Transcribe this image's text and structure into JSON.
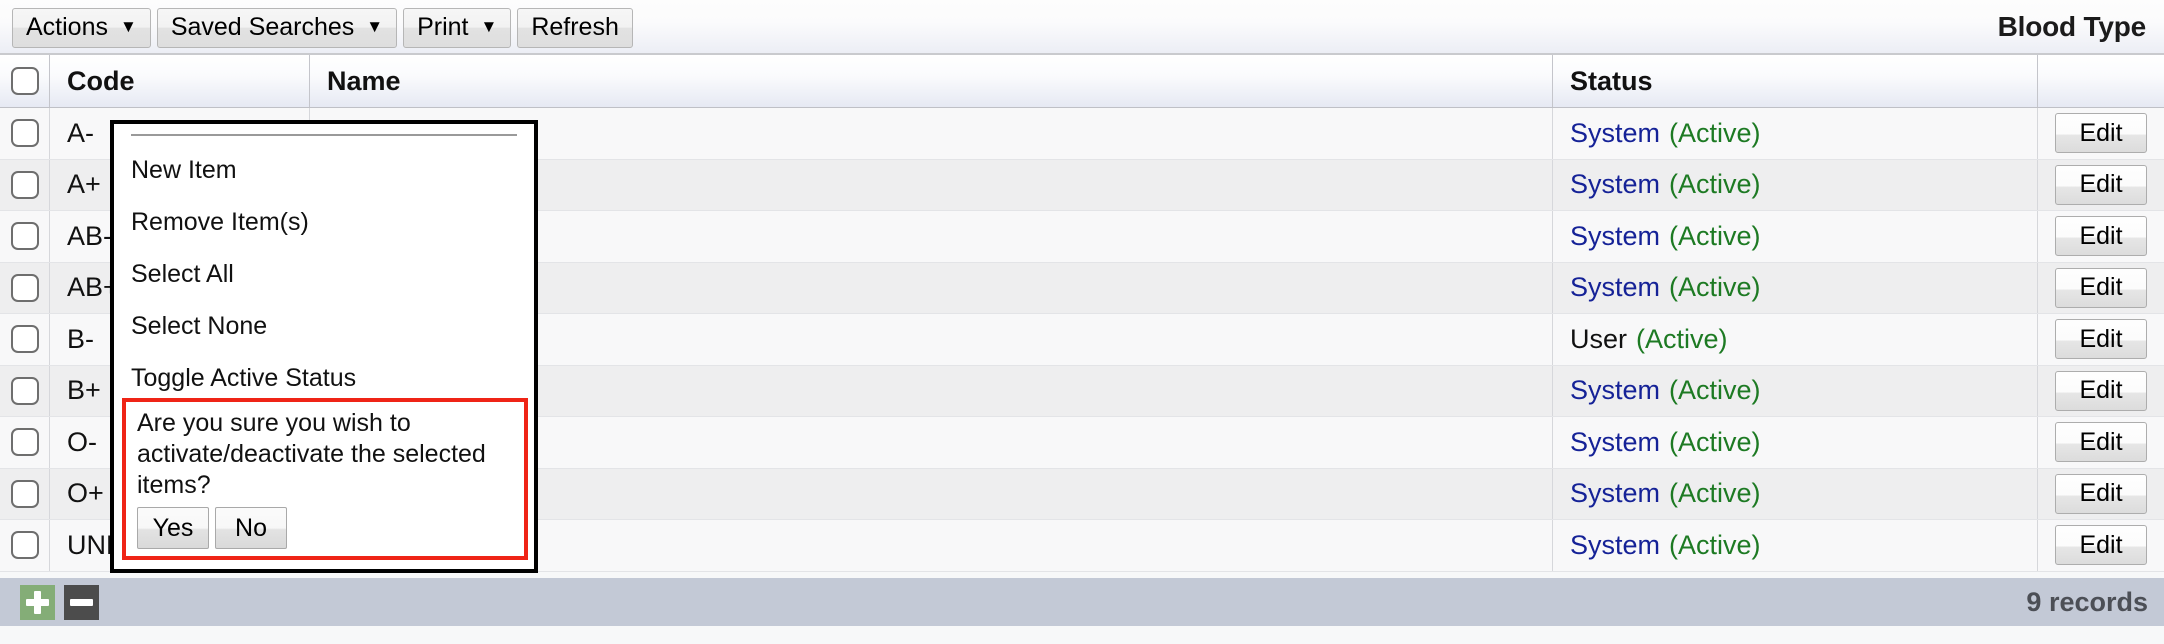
{
  "toolbar": {
    "buttons": [
      {
        "label": "Actions",
        "caret": "▼",
        "has_caret": true
      },
      {
        "label": "Saved Searches",
        "caret": "▼",
        "has_caret": true
      },
      {
        "label": "Print",
        "caret": "▼",
        "has_caret": true
      },
      {
        "label": "Refresh",
        "caret": "",
        "has_caret": false
      }
    ],
    "title": "Blood Type"
  },
  "table": {
    "columns": {
      "code": "Code",
      "name": "Name",
      "status": "Status",
      "edit": ""
    },
    "rows": [
      {
        "code": "A-",
        "name": "",
        "owner": "System",
        "owner_type": "system",
        "active": "(Active)",
        "edit": "Edit"
      },
      {
        "code": "A+",
        "name": "",
        "owner": "System",
        "owner_type": "system",
        "active": "(Active)",
        "edit": "Edit"
      },
      {
        "code": "AB-",
        "name": "",
        "owner": "System",
        "owner_type": "system",
        "active": "(Active)",
        "edit": "Edit"
      },
      {
        "code": "AB+",
        "name": "",
        "owner": "System",
        "owner_type": "system",
        "active": "(Active)",
        "edit": "Edit"
      },
      {
        "code": "B-",
        "name": "",
        "owner": "User",
        "owner_type": "user",
        "active": "(Active)",
        "edit": "Edit"
      },
      {
        "code": "B+",
        "name": "",
        "owner": "System",
        "owner_type": "system",
        "active": "(Active)",
        "edit": "Edit"
      },
      {
        "code": "O-",
        "name": "",
        "owner": "System",
        "owner_type": "system",
        "active": "(Active)",
        "edit": "Edit"
      },
      {
        "code": "O+",
        "name": "",
        "owner": "System",
        "owner_type": "system",
        "active": "(Active)",
        "edit": "Edit"
      },
      {
        "code": "UNK",
        "name": "",
        "owner": "System",
        "owner_type": "system",
        "active": "(Active)",
        "edit": "Edit"
      }
    ]
  },
  "context_menu": {
    "items": [
      {
        "label": "New Item"
      },
      {
        "label": "Remove Item(s)"
      },
      {
        "label": "Select All"
      },
      {
        "label": "Select None"
      },
      {
        "label": "Toggle Active Status"
      }
    ],
    "confirm": {
      "message": "Are you sure you wish to activate/deactivate the selected items?",
      "yes_label": "Yes",
      "no_label": "No"
    }
  },
  "footer": {
    "add_icon": "plus-icon",
    "remove_icon": "minus-icon",
    "records": "9 records"
  },
  "colors": {
    "accent_red": "#ef2416",
    "status_system": "#152297",
    "status_active": "#1d7a23",
    "add_green": "#84ad77",
    "remove_gray": "#4c4c4c",
    "footer_bg": "#c3c9d6"
  }
}
